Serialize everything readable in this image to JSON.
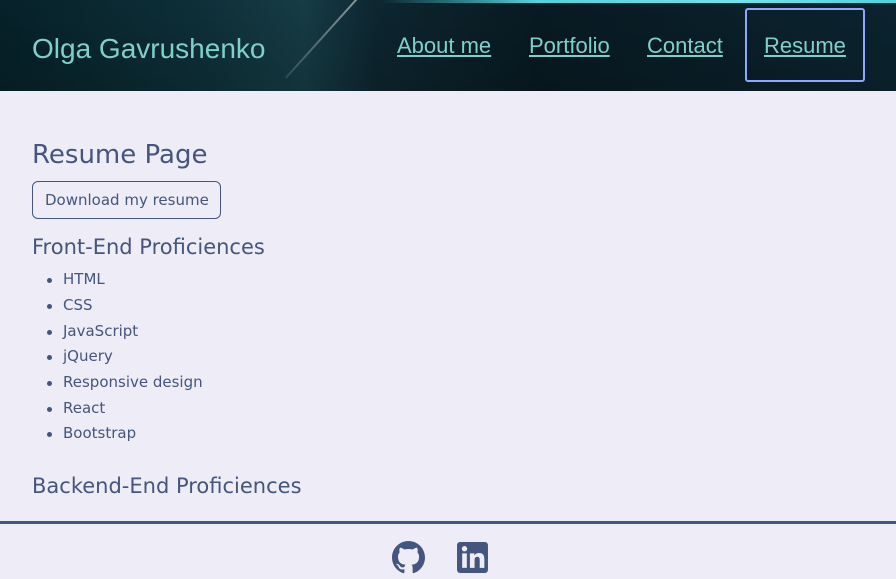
{
  "header": {
    "brand": "Olga Gavrushenko",
    "nav": [
      {
        "label": "About me"
      },
      {
        "label": "Portfolio"
      },
      {
        "label": "Contact"
      },
      {
        "label": "Resume",
        "active": true
      }
    ]
  },
  "main": {
    "title": "Resume Page",
    "download_label": "Download my resume",
    "frontend_title": "Front-End Proficiences",
    "frontend_skills": [
      "HTML",
      "CSS",
      "JavaScript",
      "jQuery",
      "Responsive design",
      "React",
      "Bootstrap"
    ],
    "backend_title": "Backend-End Proficiences"
  },
  "footer": {
    "icons": [
      "github-icon",
      "linkedin-icon"
    ]
  },
  "colors": {
    "text": "#44567d",
    "accent": "#7ed0c8",
    "background": "#eeecf6",
    "active_border": "#8ea8ff"
  }
}
